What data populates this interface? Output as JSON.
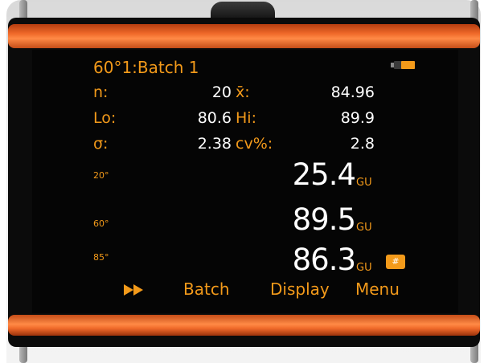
{
  "header": {
    "title": "60°1:Batch 1",
    "battery_icon": "battery-icon",
    "battery_level": 0.65
  },
  "stats": {
    "n_label": "n:",
    "n_value": "20",
    "mean_label": "x̄:",
    "mean_value": "84.96",
    "lo_label": "Lo:",
    "lo_value": "80.6",
    "hi_label": "Hi:",
    "hi_value": "89.9",
    "sigma_label": "σ:",
    "sigma_value": "2.38",
    "cv_label": "cv%:",
    "cv_value": "2.8"
  },
  "readings": [
    {
      "angle": "20°",
      "value": "25.4",
      "unit": "GU"
    },
    {
      "angle": "60°",
      "value": "89.5",
      "unit": "GU"
    },
    {
      "angle": "85°",
      "value": "86.3",
      "unit": "GU"
    }
  ],
  "folder_badge": {
    "icon": "hash-folder-icon",
    "symbol": "#"
  },
  "softkeys": {
    "forward_icon": "fast-forward-icon",
    "batch": "Batch",
    "display": "Display",
    "menu": "Menu"
  },
  "colors": {
    "accent": "#f39a1a",
    "value_text": "#ffffff",
    "screen_bg": "#050505",
    "device_orange": "#f06a2a"
  }
}
